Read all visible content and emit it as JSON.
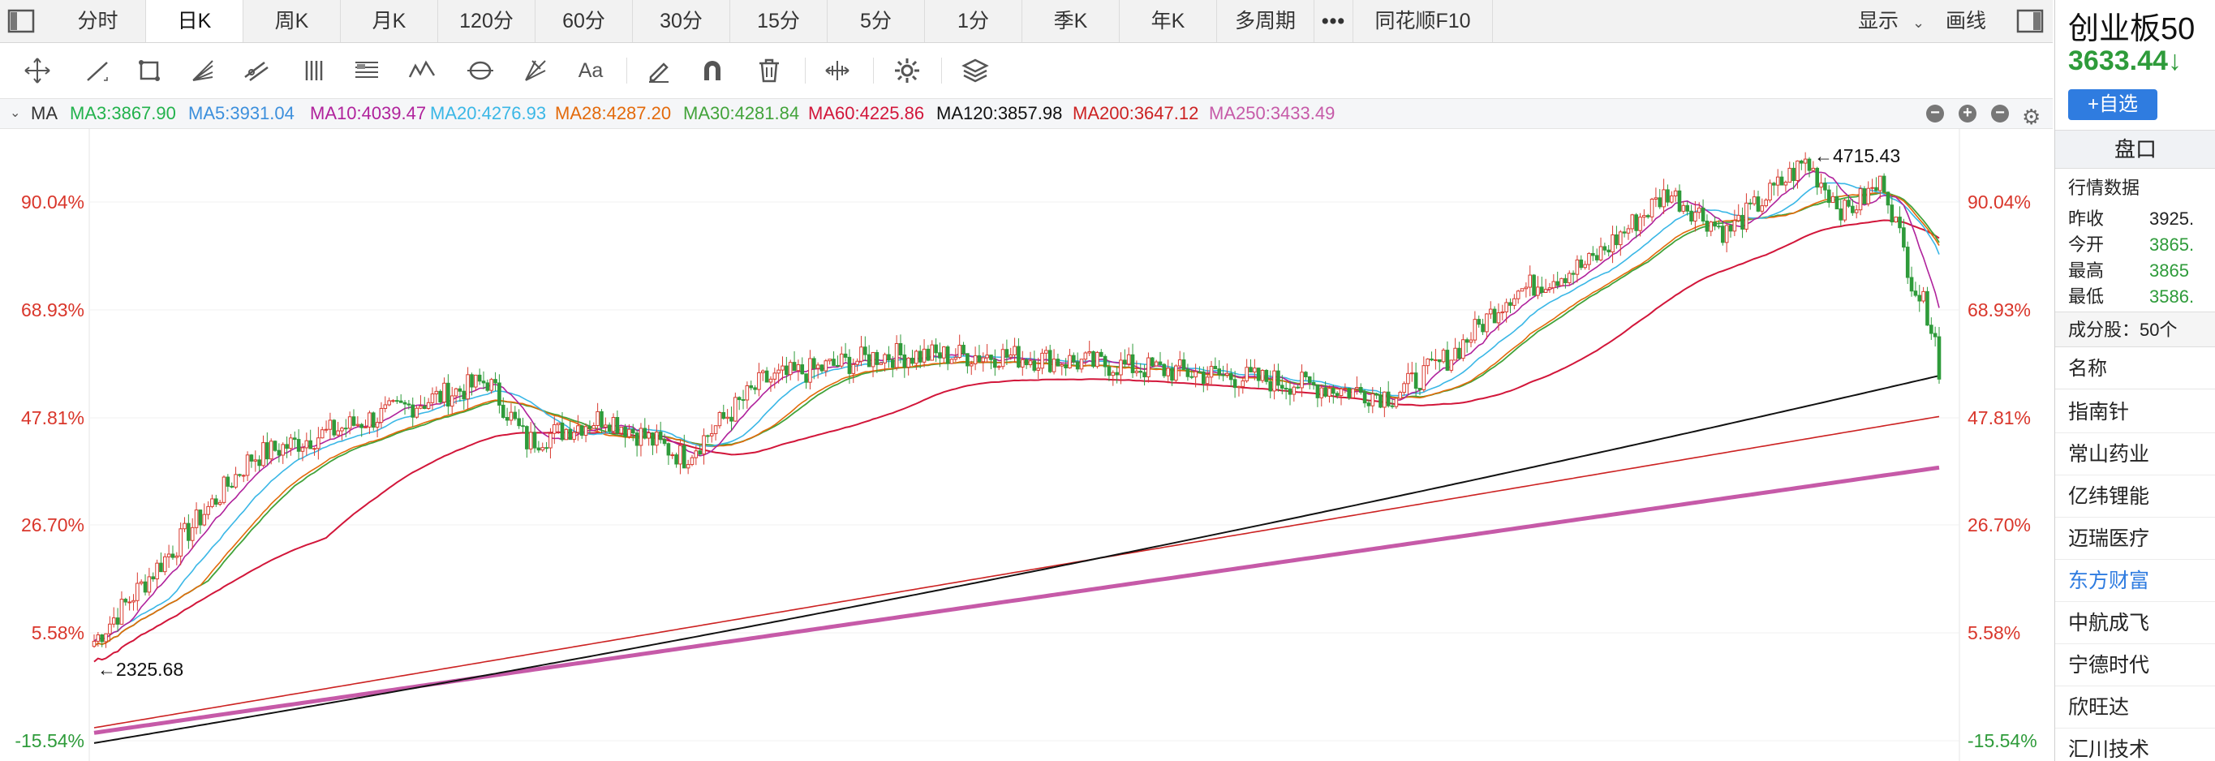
{
  "tabs": [
    {
      "label": "分时",
      "active": false
    },
    {
      "label": "日K",
      "active": true
    },
    {
      "label": "周K",
      "active": false
    },
    {
      "label": "月K",
      "active": false
    },
    {
      "label": "120分",
      "active": false
    },
    {
      "label": "60分",
      "active": false
    },
    {
      "label": "30分",
      "active": false
    },
    {
      "label": "15分",
      "active": false
    },
    {
      "label": "5分",
      "active": false
    },
    {
      "label": "1分",
      "active": false
    },
    {
      "label": "季K",
      "active": false
    },
    {
      "label": "年K",
      "active": false
    },
    {
      "label": "多周期",
      "active": false
    },
    {
      "label": "•••",
      "active": false
    },
    {
      "label": "同花顺F10",
      "active": false
    }
  ],
  "header": {
    "display_label": "显示",
    "draw_label": "画线"
  },
  "toolbar": {
    "text_tool_label": "Aa"
  },
  "ma": {
    "label": "MA",
    "items": [
      {
        "text": "MA3:3867.90",
        "color": "#22b24c"
      },
      {
        "text": "MA5:3931.04",
        "color": "#3c8fdc"
      },
      {
        "text": "MA10:4039.47",
        "color": "#b0229c"
      },
      {
        "text": "MA20:4276.93",
        "color": "#3ab7e6"
      },
      {
        "text": "MA28:4287.20",
        "color": "#e36a0b"
      },
      {
        "text": "MA30:4281.84",
        "color": "#42a33a"
      },
      {
        "text": "MA60:4225.86",
        "color": "#d2163a"
      },
      {
        "text": "MA120:3857.98",
        "color": "#111111"
      },
      {
        "text": "MA200:3647.12",
        "color": "#cc2222"
      },
      {
        "text": "MA250:3433.49",
        "color": "#c65aa8"
      }
    ]
  },
  "chart_data": {
    "type": "candlestick",
    "y_axis_ticks": [
      "90.04%",
      "68.93%",
      "47.81%",
      "26.70%",
      "5.58%",
      "-15.54%"
    ],
    "y_range_pct": [
      -15.54,
      99.5
    ],
    "annotations": {
      "high": "4715.43",
      "low": "2325.68"
    },
    "colors": {
      "up": "#d93a2f",
      "down": "#2e9b3a"
    }
  },
  "right_panel": {
    "title": "创业板50",
    "price": "3633.44↓",
    "add_button": "+自选",
    "pankou_label": "盘口",
    "quote_title": "行情数据",
    "quote_rows": [
      {
        "label": "昨收",
        "value": "3925."
      },
      {
        "label": "今开",
        "value": "3865."
      },
      {
        "label": "最高",
        "value": "3865"
      },
      {
        "label": "最低",
        "value": "3586."
      }
    ],
    "components_label": "成分股：50个",
    "list_header": "名称",
    "stocks": [
      "指南针",
      "常山药业",
      "亿纬锂能",
      "迈瑞医疗",
      "东方财富",
      "中航成飞",
      "宁德时代",
      "欣旺达",
      "汇川技术"
    ]
  }
}
